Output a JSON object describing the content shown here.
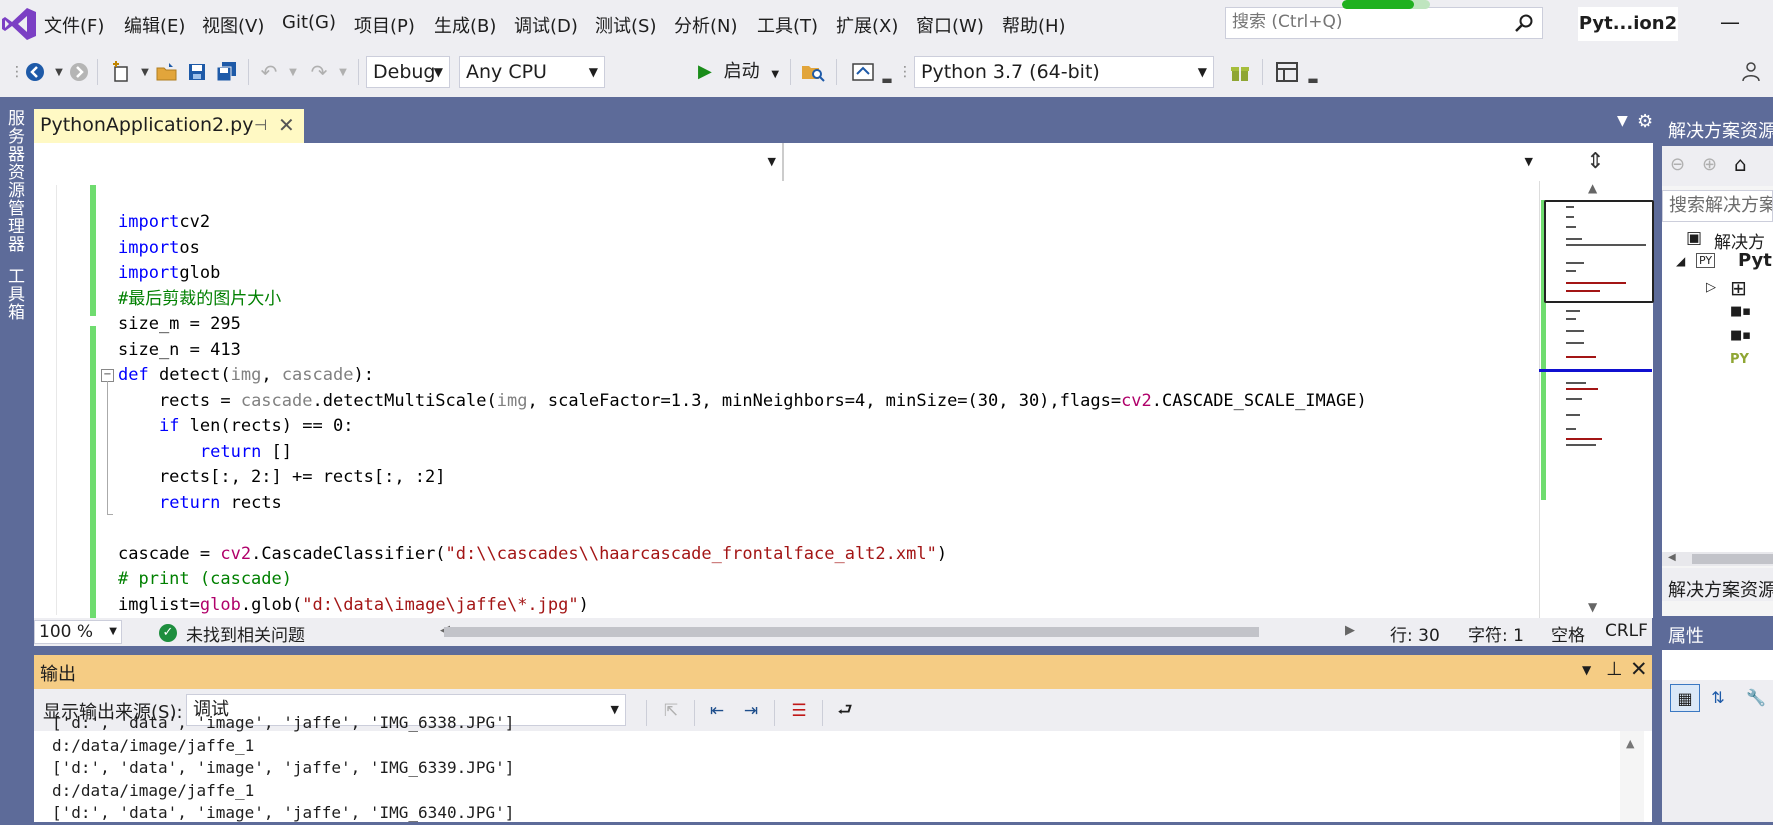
{
  "menubar": {
    "items": [
      "文件(F)",
      "编辑(E)",
      "视图(V)",
      "Git(G)",
      "项目(P)",
      "生成(B)",
      "调试(D)",
      "测试(S)",
      "分析(N)",
      "工具(T)",
      "扩展(X)",
      "窗口(W)",
      "帮助(H)"
    ],
    "search_placeholder": "搜索 (Ctrl+Q)",
    "solution_name": "Pyt...ion2",
    "minimize": "—"
  },
  "toolbar": {
    "config": "Debug",
    "platform": "Any CPU",
    "start_label": "启动",
    "python_env": "Python 3.7 (64-bit)"
  },
  "left_tabs": [
    "服务器资源管理器",
    "工具箱"
  ],
  "document_tab": {
    "title": "PythonApplication2.py",
    "pin": "⊣",
    "close": "✕"
  },
  "editor": {
    "code_lines": [
      [
        [
          "kw",
          "import"
        ],
        [
          "",
          "cv2"
        ]
      ],
      [
        [
          "kw",
          "import"
        ],
        [
          "",
          "os"
        ]
      ],
      [
        [
          "kw",
          "import"
        ],
        [
          "",
          "glob"
        ]
      ],
      [
        [
          "cm",
          "#最后剪裁的图片大小"
        ]
      ],
      [
        [
          "",
          "size_m = 295"
        ]
      ],
      [
        [
          "",
          "size_n = 413"
        ]
      ],
      [
        [
          "kw",
          "def"
        ],
        [
          "",
          " detect("
        ],
        [
          "par",
          "img"
        ],
        [
          "",
          ", "
        ],
        [
          "par",
          "cascade"
        ],
        [
          "",
          "):"
        ]
      ],
      [
        [
          "",
          "    rects = "
        ],
        [
          "par",
          "cascade"
        ],
        [
          "",
          ".detectMultiScale("
        ],
        [
          "par",
          "img"
        ],
        [
          "",
          ", scaleFactor=1.3, minNeighbors=4, minSize=(30, 30),flags="
        ],
        [
          "mod",
          "cv2"
        ],
        [
          "",
          ".CASCADE_SCALE_IMAGE)"
        ]
      ],
      [
        [
          "",
          "    "
        ],
        [
          "kw",
          "if"
        ],
        [
          "",
          " len(rects) == 0:"
        ]
      ],
      [
        [
          "",
          "        "
        ],
        [
          "kw",
          "return"
        ],
        [
          "",
          " []"
        ]
      ],
      [
        [
          "",
          "    rects[:, 2:] += rects[:, :2]"
        ]
      ],
      [
        [
          "",
          "    "
        ],
        [
          "kw",
          "return"
        ],
        [
          "",
          " rects"
        ]
      ],
      [
        [
          "",
          ""
        ]
      ],
      [
        [
          "",
          "cascade = "
        ],
        [
          "mod",
          "cv2"
        ],
        [
          "",
          ".CascadeClassifier("
        ],
        [
          "str",
          "\"d:\\\\cascades\\\\haarcascade_frontalface_alt2.xml\""
        ],
        [
          "",
          ")"
        ]
      ],
      [
        [
          "cm",
          "# print (cascade)"
        ]
      ],
      [
        [
          "",
          "imglist="
        ],
        [
          "mod",
          "glob"
        ],
        [
          "",
          ".glob("
        ],
        [
          "str",
          "\"d:\\data\\image\\jaffe\\*.jpg\""
        ],
        [
          "",
          ")"
        ]
      ]
    ]
  },
  "status": {
    "zoom": "100 %",
    "issues": "未找到相关问题",
    "line": "行: 30",
    "char": "字符: 1",
    "spaces": "空格",
    "eol": "CRLF"
  },
  "output": {
    "title": "输出",
    "source_label": "显示输出来源(S):",
    "source_value": "调试",
    "lines": [
      "['d:', 'data', 'image', 'jaffe', 'IMG_6338.JPG']",
      "d:/data/image/jaffe_1",
      "['d:', 'data', 'image', 'jaffe', 'IMG_6339.JPG']",
      "d:/data/image/jaffe_1",
      "['d:', 'data', 'image', 'jaffe', 'IMG_6340.JPG']"
    ]
  },
  "solution_explorer": {
    "title": "解决方案资源",
    "search_placeholder": "搜索解决方案",
    "tree": [
      "解决方",
      "Pyt"
    ],
    "footer": "解决方案资源"
  },
  "properties": {
    "title": "属性"
  },
  "colors": {
    "accent": "#5d6b99",
    "chrome": "#eeeef2",
    "output_title": "#f5cc84",
    "doc_tab": "#fff9c4",
    "change_margin": "#6fdc6f"
  },
  "build_progress": 0.82
}
